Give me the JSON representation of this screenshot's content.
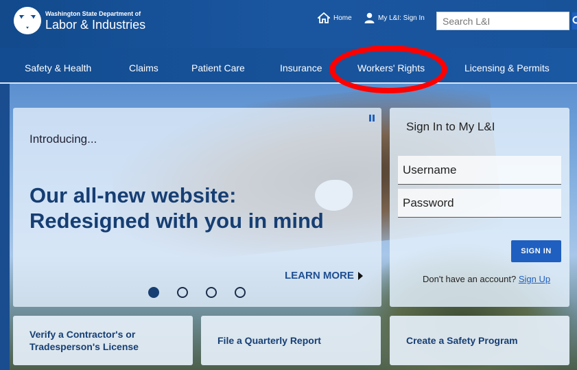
{
  "header": {
    "logo_line1": "Washington State Department of",
    "logo_line2": "Labor & Industries",
    "home_label": "Home",
    "myli_label": "My L&I: Sign In",
    "search_placeholder": "Search L&I"
  },
  "nav": {
    "items": [
      {
        "label": "Safety & Health"
      },
      {
        "label": "Claims"
      },
      {
        "label": "Patient Care"
      },
      {
        "label": "Insurance"
      },
      {
        "label": "Workers' Rights"
      },
      {
        "label": "Licensing & Permits"
      }
    ]
  },
  "feature": {
    "intro": "Introducing...",
    "headline_line1": "Our all-new website:",
    "headline_line2": "Redesigned with you in mind",
    "learn_more": "LEARN MORE",
    "slides": 4,
    "active_slide": 1
  },
  "signin": {
    "title": "Sign In to My L&I",
    "username_placeholder": "Username",
    "password_placeholder": "Password",
    "button": "SIGN IN",
    "no_account_text": "Don't have an account?",
    "signup_link": "Sign Up"
  },
  "tiles": [
    {
      "line1": "Verify a Contractor's or",
      "line2": "Tradesperson's License"
    },
    {
      "line1": "File a Quarterly Report",
      "line2": ""
    },
    {
      "line1": "Create a Safety Program",
      "line2": ""
    }
  ],
  "colors": {
    "brand_blue": "#1a56a0",
    "button_blue": "#1f5fbf",
    "headline_navy": "#163e73",
    "highlight_red": "#ff0000"
  },
  "icons": {
    "home": "home-icon",
    "user": "user-icon",
    "search": "search-icon",
    "pause": "pause-icon",
    "learn_more_arrow": "triangle-right-icon"
  }
}
